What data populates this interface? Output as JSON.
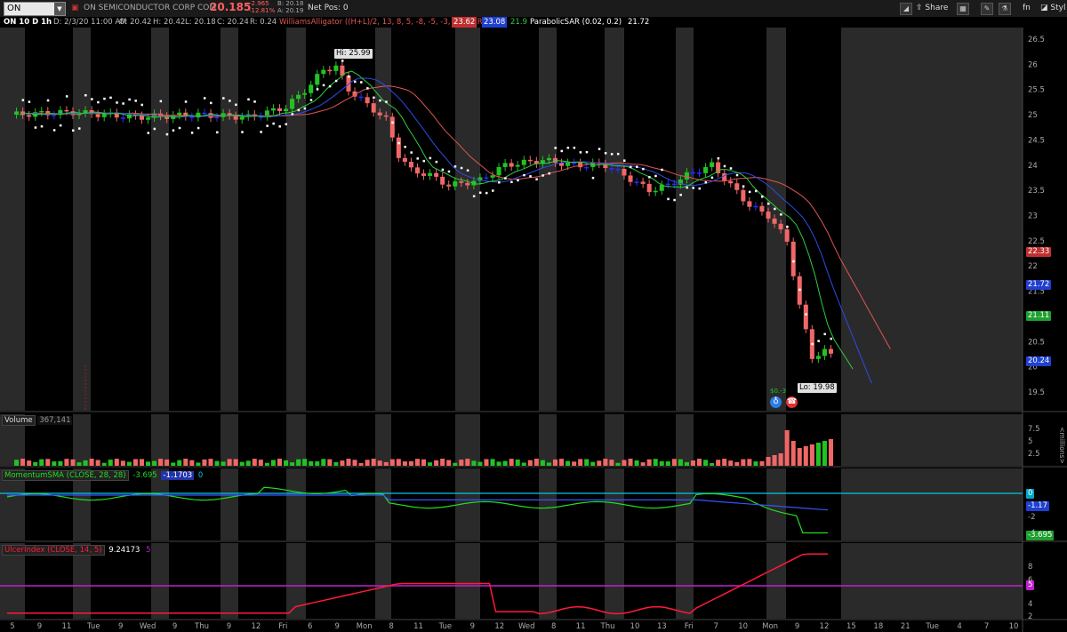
{
  "toolbar": {
    "symbol": "ON",
    "company": "ON SEMICONDUCTOR CORP COM",
    "last": "20.185",
    "change": "-2.965",
    "change_pct": "-12.81%",
    "bid": "B: 20.18",
    "ask": "A: 20.19",
    "net_pos": "Net Pos: 0",
    "share_label": "Share",
    "style_label": "Styl",
    "fn_label": "fn"
  },
  "infobar": {
    "timeframe": "ON 10 D 1h",
    "date": "D: 2/3/20 11:00 AM",
    "open": "O: 20.42",
    "high": "H: 20.42",
    "low": "L: 20.18",
    "close": "C: 20.24",
    "range": "R: 0.24",
    "alligator_label": "WilliamsAlligator ((H+L)/2, 13, 8, 5, -8, -5, -3, WILDERS)",
    "alligator_jaw": "23.62",
    "alligator_teeth": "23.08",
    "alligator_lips": "21.9",
    "psar_label": "ParabolicSAR (0.02, 0.2)",
    "psar_value": "21.72"
  },
  "price_panel": {
    "hi_label": "Hi: 25.99",
    "lo_label": "Lo: 19.98",
    "event_label": "$0.-3",
    "y_ticks": [
      "26.5",
      "26",
      "25.5",
      "25",
      "24.5",
      "24",
      "23.5",
      "23",
      "22.5",
      "22",
      "21.5",
      "21",
      "20.5",
      "20",
      "19.5"
    ],
    "axis_tags": {
      "jaw": "22.33",
      "teeth": "21.72",
      "lips": "21.11",
      "last": "20.24"
    }
  },
  "volume_panel": {
    "label": "Volume",
    "value": "367,141",
    "y_ticks": [
      "7.5",
      "5",
      "2.5"
    ],
    "unit": "<millions>"
  },
  "momentum_panel": {
    "label": "MomentumSMA (CLOSE, 28, 28)",
    "value1": "-3.695",
    "value2": "-1.1703",
    "value3": "0",
    "y_ticks": [
      "-2",
      "-4"
    ],
    "axis_tags": {
      "zero": "0",
      "sma": "-1.17",
      "mom": "-3.695"
    }
  },
  "ulcer_panel": {
    "label": "UlcerIndex (CLOSE, 14, 5)",
    "value": "9.24173",
    "level": "5",
    "y_ticks": [
      "8",
      "6",
      "4",
      "2"
    ],
    "axis_tags": {
      "level": "5"
    }
  },
  "x_axis": [
    "5",
    "9",
    "11",
    "Tue",
    "9",
    "Wed",
    "9",
    "Thu",
    "9",
    "12",
    "Fri",
    "6",
    "9",
    "Mon",
    "8",
    "11",
    "Tue",
    "9",
    "12",
    "Wed",
    "8",
    "11",
    "Thu",
    "10",
    "13",
    "Fri",
    "7",
    "10",
    "Mon",
    "9",
    "12",
    "15",
    "18",
    "21",
    "Tue",
    "4",
    "7",
    "10"
  ],
  "colors": {
    "up": "#22c322",
    "down": "#f06767",
    "flat": "#2a2aff",
    "jaw": "#e05555",
    "teeth": "#2f4be8",
    "lips": "#2ecc40",
    "sar": "#ffffff",
    "momentum": "#22dd22",
    "momentum_sma": "#3355ff",
    "zero_line": "#00c8e8",
    "ulcer": "#ff1a3a",
    "ulcer_level": "#c020d0"
  }
}
